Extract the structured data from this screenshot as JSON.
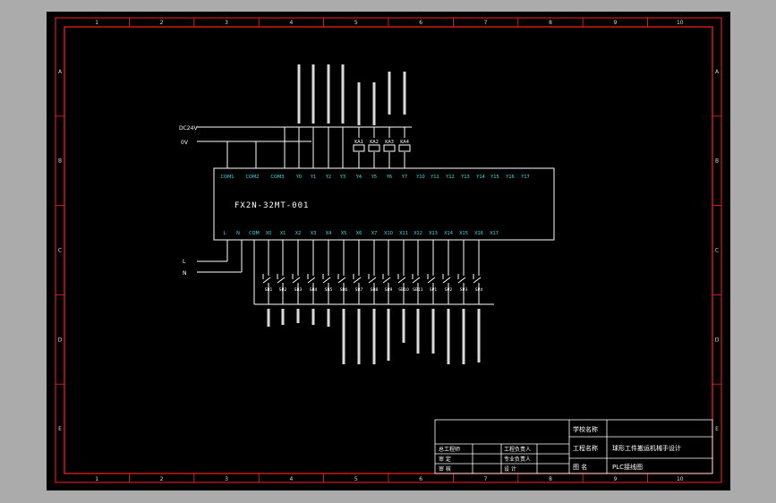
{
  "colors": {
    "background": "#ababab",
    "sheet": "#000000",
    "frame": "#ff2020",
    "line": "#ffffff",
    "terminal_text": "#33e0ee",
    "label_text": "#ffffff",
    "grid_text": "#dddddd"
  },
  "grid": {
    "columns": [
      "1",
      "2",
      "3",
      "4",
      "5",
      "6",
      "7",
      "8",
      "9",
      "10"
    ],
    "rows": [
      "A",
      "B",
      "C",
      "D",
      "E"
    ]
  },
  "power": {
    "dc24v": "DC24V",
    "zero_v": "0V",
    "line": "L",
    "neutral": "N"
  },
  "plc": {
    "model": "FX2N-32MT-001",
    "top_terminals": [
      "COM1",
      "COM2",
      "COM3",
      "Y0",
      "Y1",
      "Y2",
      "Y3",
      "Y4",
      "Y5",
      "Y6",
      "Y7",
      "Y10",
      "Y11",
      "Y12",
      "Y13",
      "Y14",
      "Y15",
      "Y16",
      "Y17"
    ],
    "bottom_terminals": [
      "L",
      "N",
      "COM",
      "X0",
      "X1",
      "X2",
      "X3",
      "X4",
      "X5",
      "X6",
      "X7",
      "X10",
      "X11",
      "X12",
      "X13",
      "X14",
      "X15",
      "X16",
      "X17"
    ]
  },
  "relays": [
    "KA1",
    "KA2",
    "KA3",
    "KA4"
  ],
  "input_devices": [
    "SB1",
    "SB2",
    "SB3",
    "SB4",
    "SB5",
    "SB6",
    "SB7",
    "SB8",
    "SB9",
    "SB10",
    "SB11",
    "SP1",
    "SP2",
    "SP3",
    "SP4"
  ],
  "title_block": {
    "school_label": "学校名称",
    "project_label": "工程名称",
    "project_value": "球形工件搬运机械手设计",
    "drawing_label": "图    名",
    "drawing_value": "PLC接线图",
    "row1_left": "总工程师",
    "row1_right": "工程负责人",
    "row2_left": "审    定",
    "row2_right": "专业负责人",
    "row3_left": "审    核",
    "row3_right": "设    计"
  }
}
